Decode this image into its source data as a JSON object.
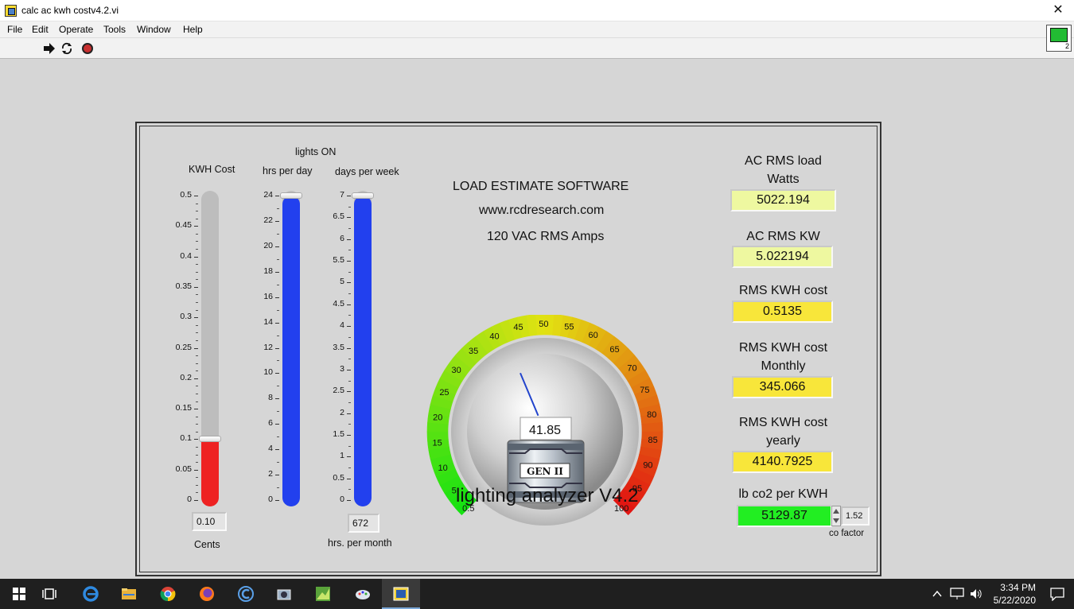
{
  "window": {
    "title": "calc ac kwh costv4.2.vi",
    "close_glyph": "✕",
    "vi_icon_number": "2"
  },
  "menu": [
    "File",
    "Edit",
    "Operate",
    "Tools",
    "Window",
    "Help"
  ],
  "toolbar": {
    "run_icon": "run-arrow-icon",
    "run_continuous_icon": "run-continuously-icon",
    "abort_icon": "abort-stop-icon"
  },
  "panel": {
    "kwh_cost": {
      "label": "KWH Cost",
      "value": 0.1,
      "display": "0.10",
      "units_label": "Cents",
      "scale": [
        "0.5",
        "0.45",
        "0.4",
        "0.35",
        "0.3",
        "0.25",
        "0.2",
        "0.15",
        "0.1",
        "0.05",
        "0"
      ],
      "range": [
        0,
        0.5
      ],
      "fill_color": "#ee2222"
    },
    "lights_on_label": "lights ON",
    "hrs_per_day": {
      "label": "hrs per day",
      "value": 24,
      "scale": [
        "24",
        "22",
        "20",
        "18",
        "16",
        "14",
        "12",
        "10",
        "8",
        "6",
        "4",
        "2",
        "0"
      ],
      "range": [
        0,
        24
      ],
      "fill_color": "#2240ee"
    },
    "days_per_week": {
      "label": "days per week",
      "value": 7,
      "scale": [
        "7",
        "6.5",
        "6",
        "5.5",
        "5",
        "4.5",
        "4",
        "3.5",
        "3",
        "2.5",
        "2",
        "1.5",
        "1",
        "0.5",
        "0"
      ],
      "range": [
        0,
        7
      ],
      "fill_color": "#2240ee",
      "month_display": "672",
      "month_label": "hrs. per month"
    },
    "header": {
      "line1": "LOAD ESTIMATE SOFTWARE",
      "line2": "www.rcdresearch.com",
      "line3": "120 VAC RMS Amps"
    },
    "gauge": {
      "value": 41.85,
      "display": "41.85",
      "range": [
        0.5,
        100
      ],
      "ticks": [
        "0.5",
        "5",
        "10",
        "15",
        "20",
        "25",
        "30",
        "35",
        "40",
        "45",
        "50",
        "55",
        "60",
        "65",
        "70",
        "75",
        "80",
        "85",
        "90",
        "95",
        "100"
      ],
      "badge": "GEN II"
    },
    "app_title": "lighting analyzer V4.2",
    "outputs": {
      "watts_label_1": "AC RMS load",
      "watts_label_2": "Watts",
      "watts_value": "5022.194",
      "kw_label": "AC RMS KW",
      "kw_value": "5.022194",
      "kwh_cost_label": "RMS KWH cost",
      "kwh_cost_value": "0.5135",
      "monthly_label_1": "RMS KWH cost",
      "monthly_label_2": "Monthly",
      "monthly_value": "345.066",
      "yearly_label_1": "RMS KWH cost",
      "yearly_label_2": "yearly",
      "yearly_value": "4140.7925",
      "co2_label": "lb co2 per KWH",
      "co2_value": "5129.87",
      "co_factor_value": "1.52",
      "co_factor_label": "co factor"
    },
    "colors": {
      "pale_yellow": "#eef8a0",
      "yellow": "#f8e63a",
      "green": "#22ee22"
    }
  },
  "taskbar": {
    "icons": [
      "windows-start-icon",
      "task-view-icon",
      "edge-icon",
      "file-explorer-icon",
      "chrome-icon",
      "firefox-icon",
      "ccleaner-icon",
      "camera-app-icon",
      "chart-app-icon",
      "paint-app-icon",
      "labview-app-icon"
    ],
    "time": "3:34 PM",
    "date": "5/22/2020"
  }
}
